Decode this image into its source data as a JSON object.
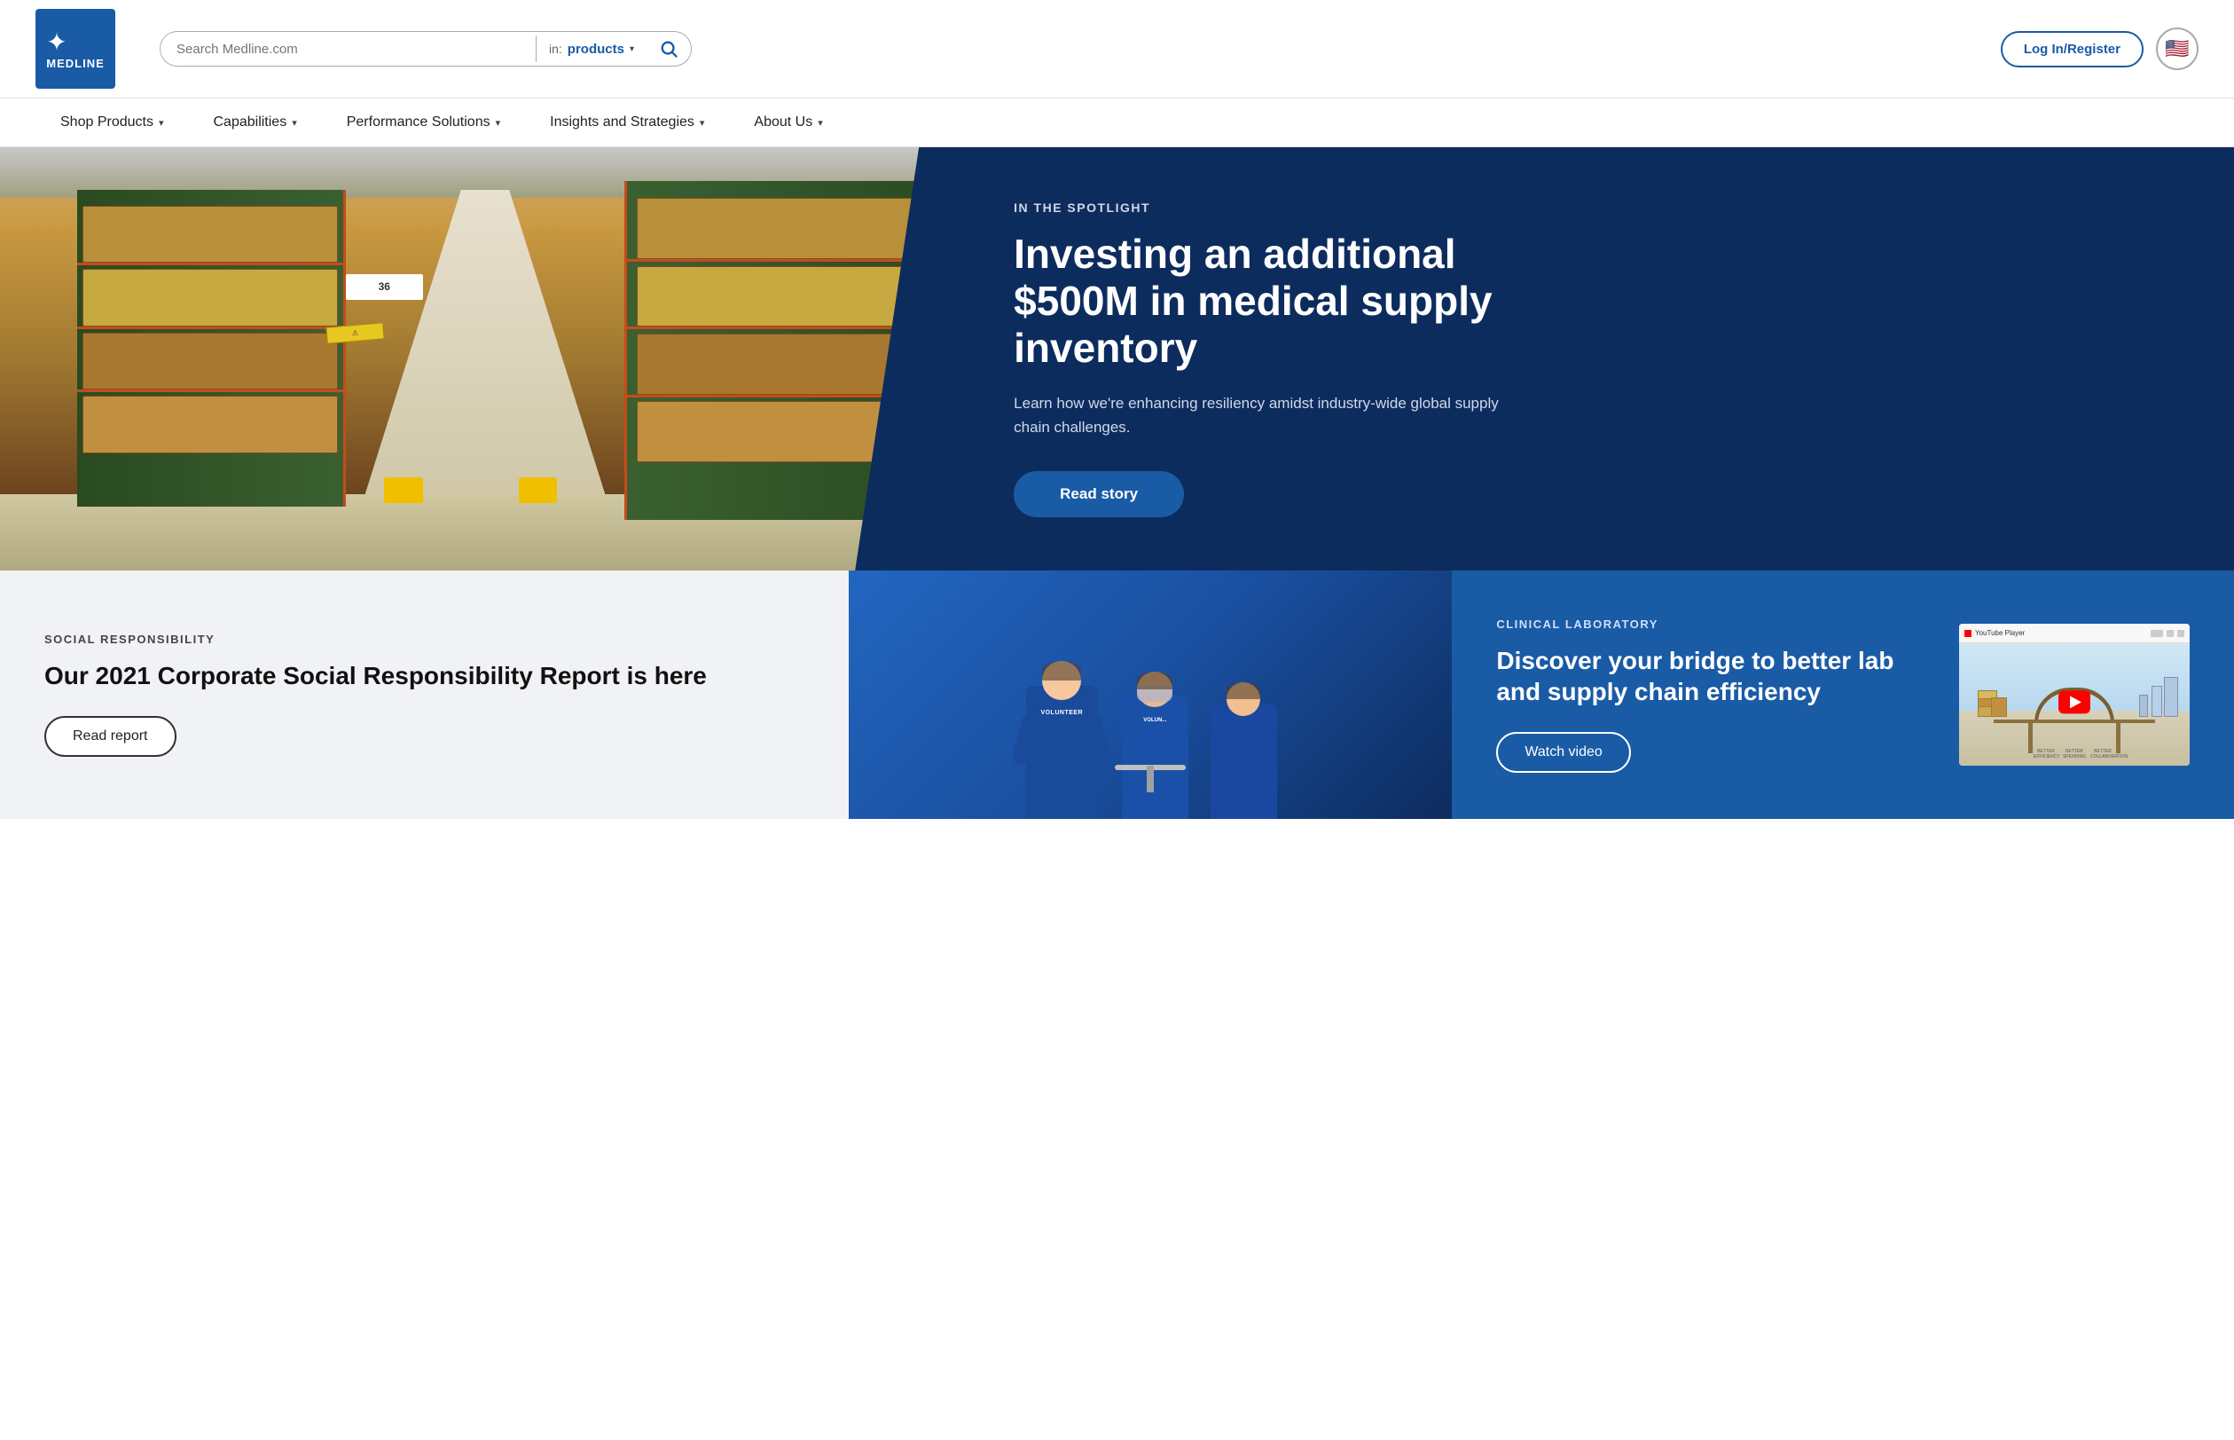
{
  "header": {
    "logo_text": "MEDLINE",
    "search_placeholder": "Search Medline.com",
    "search_in_label": "in:",
    "search_dropdown_value": "products",
    "login_label": "Log In/Register",
    "flag_emoji": "🇺🇸"
  },
  "nav": {
    "items": [
      {
        "label": "Shop Products",
        "has_dropdown": true
      },
      {
        "label": "Capabilities",
        "has_dropdown": true
      },
      {
        "label": "Performance Solutions",
        "has_dropdown": true
      },
      {
        "label": "Insights and Strategies",
        "has_dropdown": true
      },
      {
        "label": "About Us",
        "has_dropdown": true
      }
    ]
  },
  "hero": {
    "spotlight_label": "IN THE SPOTLIGHT",
    "title": "Investing an additional $500M in medical supply inventory",
    "description": "Learn how we're enhancing resiliency amidst industry-wide global supply chain challenges.",
    "cta_label": "Read story"
  },
  "cards": {
    "left": {
      "category": "SOCIAL RESPONSIBILITY",
      "title": "Our 2021 Corporate Social Responsibility Report is here",
      "cta_label": "Read report"
    },
    "right": {
      "category": "CLINICAL LABORATORY",
      "title": "Discover your bridge to better lab and supply chain efficiency",
      "cta_label": "Watch video",
      "thumbnail_label": "YouTube Player"
    }
  }
}
